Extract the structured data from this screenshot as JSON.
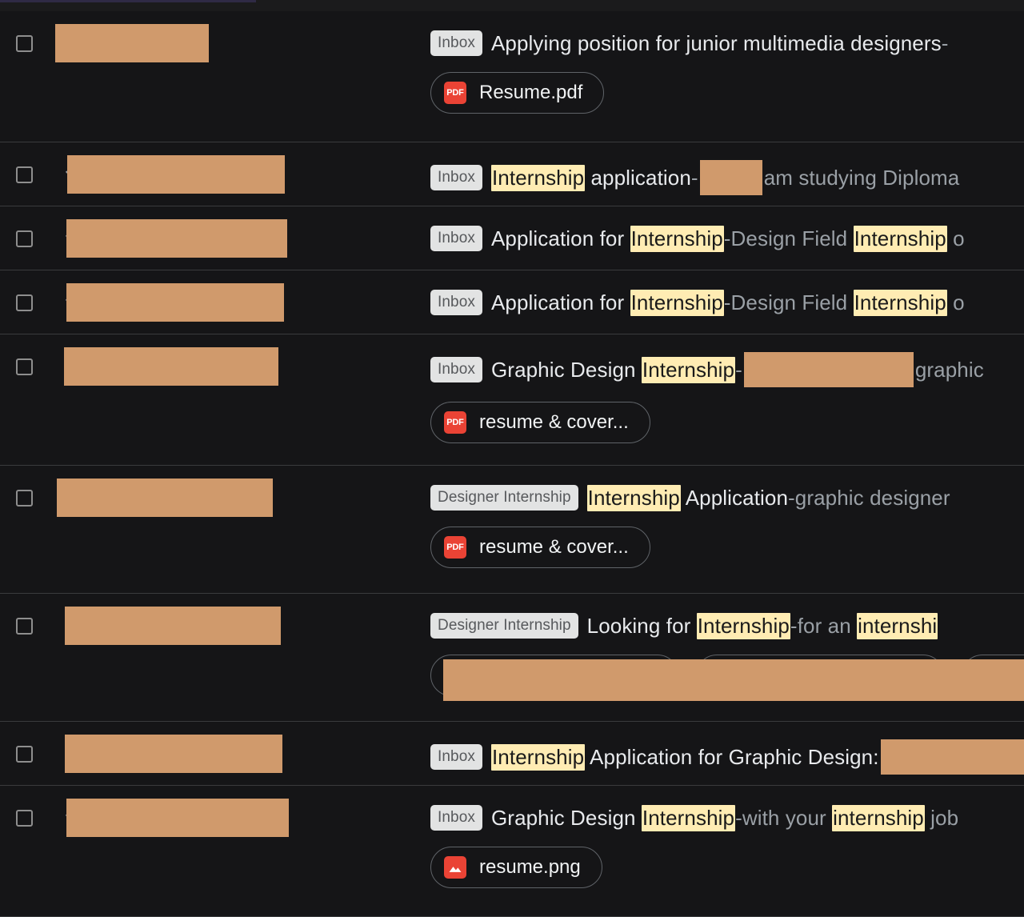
{
  "theme": {
    "background": "#131314",
    "row_background": "#151517",
    "divider": "#3a3b3d",
    "redaction_color": "#d09a6c",
    "highlight_color": "#ffecb3",
    "label_chip_bg": "#e2e3e3",
    "label_chip_text": "#57595c",
    "subject_text": "#e8eaed",
    "snippet_text": "#9aa0a6",
    "pdf_badge_color": "#ea4335",
    "top_sliver_color": "#2f2a45"
  },
  "icons": {
    "checkbox": "checkbox-unchecked-icon",
    "star": "star-outline-icon",
    "pdf": "pdf-file-icon",
    "image": "image-file-icon"
  },
  "rows": [
    {
      "label": "Inbox",
      "subject": "Applying position for junior multimedia designers",
      "separator": " - ",
      "snippet": "",
      "attachments": [
        {
          "name": "Resume.pdf",
          "type": "pdf"
        }
      ]
    },
    {
      "label": "Inbox",
      "subject_parts": [
        {
          "text": "Internship",
          "highlight": true
        },
        {
          "text": " application ",
          "highlight": false
        }
      ],
      "separator": "- ",
      "snippet": " am studying Diploma",
      "attachments": []
    },
    {
      "label": "Inbox",
      "subject_parts": [
        {
          "text": "Application for ",
          "highlight": false
        },
        {
          "text": "Internship",
          "highlight": true
        }
      ],
      "separator": " - ",
      "snippet_parts": [
        {
          "text": "Design Field ",
          "highlight": false
        },
        {
          "text": "Internship",
          "highlight": true
        },
        {
          "text": " o",
          "highlight": false
        }
      ],
      "attachments": []
    },
    {
      "label": "Inbox",
      "subject_parts": [
        {
          "text": "Application for ",
          "highlight": false
        },
        {
          "text": "Internship",
          "highlight": true
        }
      ],
      "separator": " - ",
      "snippet_parts": [
        {
          "text": "Design Field ",
          "highlight": false
        },
        {
          "text": "Internship",
          "highlight": true
        },
        {
          "text": " o",
          "highlight": false
        }
      ],
      "attachments": []
    },
    {
      "label": "Inbox",
      "subject_parts": [
        {
          "text": "Graphic Design ",
          "highlight": false
        },
        {
          "text": "Internship",
          "highlight": true
        }
      ],
      "separator": " - ",
      "snippet": " graphic",
      "attachments": [
        {
          "name": "resume & cover...",
          "type": "pdf"
        }
      ]
    },
    {
      "label": "Designer Internship",
      "subject_parts": [
        {
          "text": "Internship",
          "highlight": true
        },
        {
          "text": " Application",
          "highlight": false
        }
      ],
      "separator": " - ",
      "snippet": "graphic designer",
      "attachments": [
        {
          "name": "resume & cover...",
          "type": "pdf"
        }
      ]
    },
    {
      "label": "Designer Internship",
      "subject_parts": [
        {
          "text": "Looking for ",
          "highlight": false
        },
        {
          "text": "Internship",
          "highlight": true
        }
      ],
      "separator": " - ",
      "snippet_parts": [
        {
          "text": "for an ",
          "highlight": false
        },
        {
          "text": "internshi",
          "highlight": true
        }
      ],
      "attachments": [
        {
          "name": "",
          "type": "redacted"
        },
        {
          "name": "",
          "type": "redacted"
        },
        {
          "name": "",
          "type": "redacted"
        }
      ]
    },
    {
      "label": "Inbox",
      "subject_parts": [
        {
          "text": "Internship",
          "highlight": true
        },
        {
          "text": " Application for Graphic Design:",
          "highlight": false
        }
      ],
      "separator": "",
      "snippet": "",
      "attachments": []
    },
    {
      "label": "Inbox",
      "subject_parts": [
        {
          "text": "Graphic Design ",
          "highlight": false
        },
        {
          "text": "Internship",
          "highlight": true
        }
      ],
      "separator": " - ",
      "snippet_parts": [
        {
          "text": "with your ",
          "highlight": false
        },
        {
          "text": "internship",
          "highlight": true
        },
        {
          "text": " job",
          "highlight": false
        }
      ],
      "attachments": [
        {
          "name": "resume.png",
          "type": "image"
        }
      ]
    }
  ]
}
